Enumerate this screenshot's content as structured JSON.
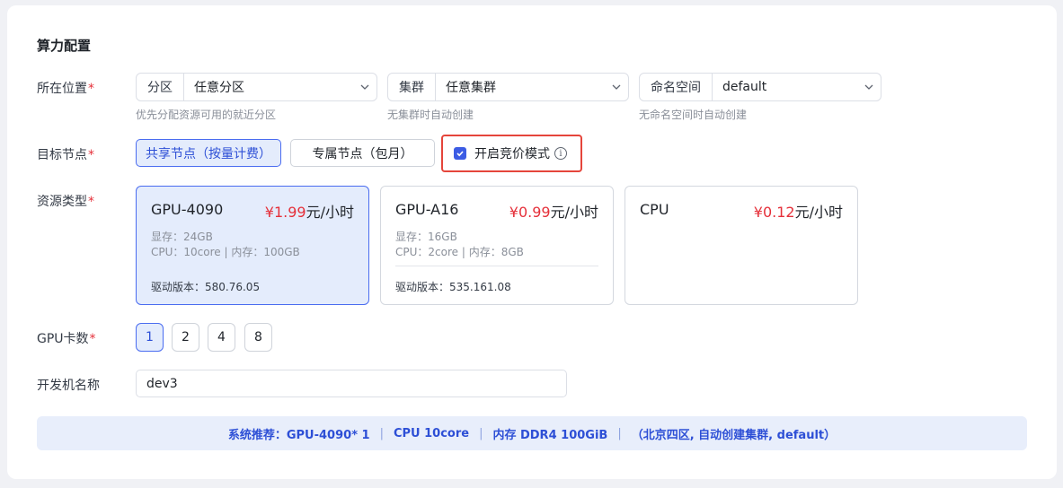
{
  "section_title": "算力配置",
  "location": {
    "label": "所在位置",
    "required_mark": "*",
    "partition": {
      "prefix": "分区",
      "value": "任意分区",
      "hint": "优先分配资源可用的就近分区"
    },
    "cluster": {
      "prefix": "集群",
      "value": "任意集群",
      "hint": "无集群时自动创建"
    },
    "namespace": {
      "prefix": "命名空间",
      "value": "default",
      "hint": "无命名空间时自动创建"
    }
  },
  "target_node": {
    "label": "目标节点",
    "required_mark": "*",
    "shared_label": "共享节点（按量计费）",
    "dedicated_label": "专属节点（包月）",
    "bidding_label": "开启竞价模式",
    "bidding_checked": true,
    "info_glyph": "i"
  },
  "resource_type": {
    "label": "资源类型",
    "required_mark": "*",
    "cards": [
      {
        "name": "GPU-4090",
        "price": "¥1.99",
        "unit": "元/小时",
        "memory": "显存：24GB",
        "cpu_mem": "CPU：10core | 内存：100GB",
        "driver": "驱动版本：580.76.05",
        "selected": true
      },
      {
        "name": "GPU-A16",
        "price": "¥0.99",
        "unit": "元/小时",
        "memory": "显存：16GB",
        "cpu_mem": "CPU：2core | 内存：8GB",
        "driver": "驱动版本：535.161.08",
        "selected": false
      },
      {
        "name": "CPU",
        "price": "¥0.12",
        "unit": "元/小时",
        "selected": false
      }
    ]
  },
  "gpu_count": {
    "label": "GPU卡数",
    "required_mark": "*",
    "options": [
      "1",
      "2",
      "4",
      "8"
    ],
    "selected": "1"
  },
  "dev_name": {
    "label": "开发机名称",
    "value": "dev3"
  },
  "summary": {
    "recommend": "系统推荐：GPU-4090* 1",
    "cpu": "CPU 10core",
    "memory": "内存 DDR4 100GiB",
    "location": "（北京四区, 自动创建集群, default）",
    "separator": "|"
  },
  "colors": {
    "accent": "#3c5ce4",
    "price_red": "#e5303a",
    "highlight_border": "#e5453b",
    "selected_bg": "#e4ecfc"
  }
}
